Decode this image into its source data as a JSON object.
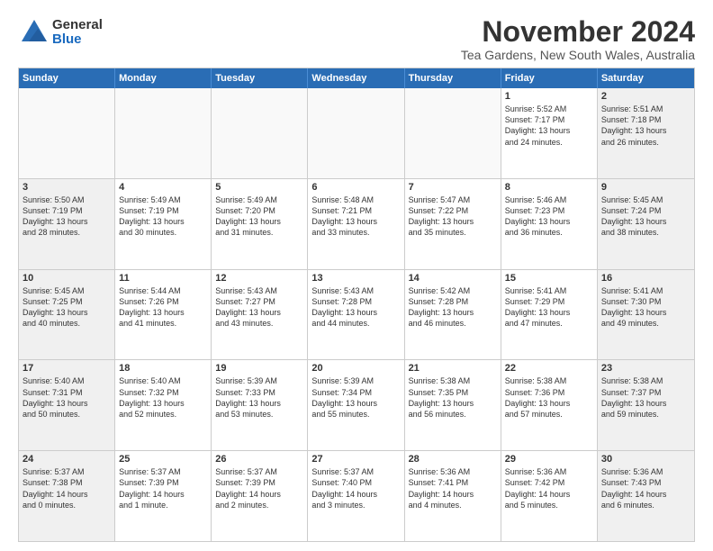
{
  "logo": {
    "general": "General",
    "blue": "Blue"
  },
  "title": "November 2024",
  "subtitle": "Tea Gardens, New South Wales, Australia",
  "days_header": [
    "Sunday",
    "Monday",
    "Tuesday",
    "Wednesday",
    "Thursday",
    "Friday",
    "Saturday"
  ],
  "weeks": [
    [
      {
        "day": "",
        "info": ""
      },
      {
        "day": "",
        "info": ""
      },
      {
        "day": "",
        "info": ""
      },
      {
        "day": "",
        "info": ""
      },
      {
        "day": "",
        "info": ""
      },
      {
        "day": "1",
        "info": "Sunrise: 5:52 AM\nSunset: 7:17 PM\nDaylight: 13 hours\nand 24 minutes."
      },
      {
        "day": "2",
        "info": "Sunrise: 5:51 AM\nSunset: 7:18 PM\nDaylight: 13 hours\nand 26 minutes."
      }
    ],
    [
      {
        "day": "3",
        "info": "Sunrise: 5:50 AM\nSunset: 7:19 PM\nDaylight: 13 hours\nand 28 minutes."
      },
      {
        "day": "4",
        "info": "Sunrise: 5:49 AM\nSunset: 7:19 PM\nDaylight: 13 hours\nand 30 minutes."
      },
      {
        "day": "5",
        "info": "Sunrise: 5:49 AM\nSunset: 7:20 PM\nDaylight: 13 hours\nand 31 minutes."
      },
      {
        "day": "6",
        "info": "Sunrise: 5:48 AM\nSunset: 7:21 PM\nDaylight: 13 hours\nand 33 minutes."
      },
      {
        "day": "7",
        "info": "Sunrise: 5:47 AM\nSunset: 7:22 PM\nDaylight: 13 hours\nand 35 minutes."
      },
      {
        "day": "8",
        "info": "Sunrise: 5:46 AM\nSunset: 7:23 PM\nDaylight: 13 hours\nand 36 minutes."
      },
      {
        "day": "9",
        "info": "Sunrise: 5:45 AM\nSunset: 7:24 PM\nDaylight: 13 hours\nand 38 minutes."
      }
    ],
    [
      {
        "day": "10",
        "info": "Sunrise: 5:45 AM\nSunset: 7:25 PM\nDaylight: 13 hours\nand 40 minutes."
      },
      {
        "day": "11",
        "info": "Sunrise: 5:44 AM\nSunset: 7:26 PM\nDaylight: 13 hours\nand 41 minutes."
      },
      {
        "day": "12",
        "info": "Sunrise: 5:43 AM\nSunset: 7:27 PM\nDaylight: 13 hours\nand 43 minutes."
      },
      {
        "day": "13",
        "info": "Sunrise: 5:43 AM\nSunset: 7:28 PM\nDaylight: 13 hours\nand 44 minutes."
      },
      {
        "day": "14",
        "info": "Sunrise: 5:42 AM\nSunset: 7:28 PM\nDaylight: 13 hours\nand 46 minutes."
      },
      {
        "day": "15",
        "info": "Sunrise: 5:41 AM\nSunset: 7:29 PM\nDaylight: 13 hours\nand 47 minutes."
      },
      {
        "day": "16",
        "info": "Sunrise: 5:41 AM\nSunset: 7:30 PM\nDaylight: 13 hours\nand 49 minutes."
      }
    ],
    [
      {
        "day": "17",
        "info": "Sunrise: 5:40 AM\nSunset: 7:31 PM\nDaylight: 13 hours\nand 50 minutes."
      },
      {
        "day": "18",
        "info": "Sunrise: 5:40 AM\nSunset: 7:32 PM\nDaylight: 13 hours\nand 52 minutes."
      },
      {
        "day": "19",
        "info": "Sunrise: 5:39 AM\nSunset: 7:33 PM\nDaylight: 13 hours\nand 53 minutes."
      },
      {
        "day": "20",
        "info": "Sunrise: 5:39 AM\nSunset: 7:34 PM\nDaylight: 13 hours\nand 55 minutes."
      },
      {
        "day": "21",
        "info": "Sunrise: 5:38 AM\nSunset: 7:35 PM\nDaylight: 13 hours\nand 56 minutes."
      },
      {
        "day": "22",
        "info": "Sunrise: 5:38 AM\nSunset: 7:36 PM\nDaylight: 13 hours\nand 57 minutes."
      },
      {
        "day": "23",
        "info": "Sunrise: 5:38 AM\nSunset: 7:37 PM\nDaylight: 13 hours\nand 59 minutes."
      }
    ],
    [
      {
        "day": "24",
        "info": "Sunrise: 5:37 AM\nSunset: 7:38 PM\nDaylight: 14 hours\nand 0 minutes."
      },
      {
        "day": "25",
        "info": "Sunrise: 5:37 AM\nSunset: 7:39 PM\nDaylight: 14 hours\nand 1 minute."
      },
      {
        "day": "26",
        "info": "Sunrise: 5:37 AM\nSunset: 7:39 PM\nDaylight: 14 hours\nand 2 minutes."
      },
      {
        "day": "27",
        "info": "Sunrise: 5:37 AM\nSunset: 7:40 PM\nDaylight: 14 hours\nand 3 minutes."
      },
      {
        "day": "28",
        "info": "Sunrise: 5:36 AM\nSunset: 7:41 PM\nDaylight: 14 hours\nand 4 minutes."
      },
      {
        "day": "29",
        "info": "Sunrise: 5:36 AM\nSunset: 7:42 PM\nDaylight: 14 hours\nand 5 minutes."
      },
      {
        "day": "30",
        "info": "Sunrise: 5:36 AM\nSunset: 7:43 PM\nDaylight: 14 hours\nand 6 minutes."
      }
    ]
  ],
  "weekend_cols": [
    0,
    6
  ]
}
